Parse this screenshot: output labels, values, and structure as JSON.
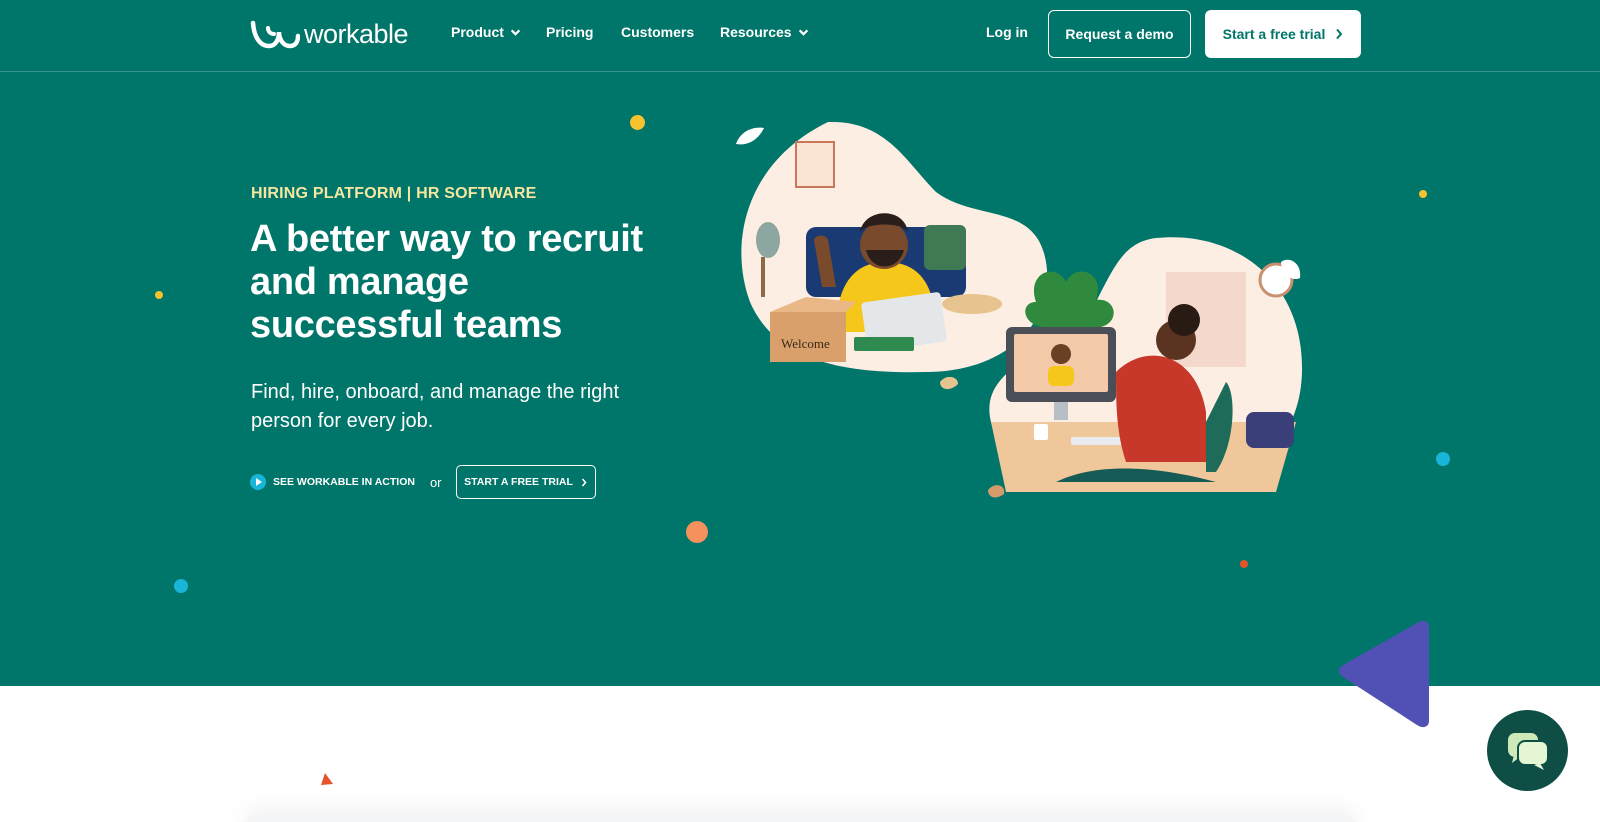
{
  "brand": {
    "name": "workable",
    "colors": {
      "hero_bg": "#00756a",
      "accent_yellow": "#f5e6a0",
      "accent_blue": "#19b5d8",
      "accent_orange": "#f4915c",
      "accent_purple": "#4f4fb0"
    }
  },
  "nav": {
    "items": [
      {
        "label": "Product",
        "has_dropdown": true
      },
      {
        "label": "Pricing",
        "has_dropdown": false
      },
      {
        "label": "Customers",
        "has_dropdown": false
      },
      {
        "label": "Resources",
        "has_dropdown": true
      }
    ],
    "login": "Log in",
    "demo": "Request a demo",
    "trial": "Start a free trial"
  },
  "hero": {
    "eyebrow": "HIRING PLATFORM | HR SOFTWARE",
    "headline": "A better way to recruit and manage successful teams",
    "subheadline": "Find, hire, onboard, and manage the right person for every job.",
    "see_action": "SEE WORKABLE IN ACTION",
    "or": "or",
    "trial_small": "START A FREE TRIAL",
    "illustration_label": "Welcome"
  },
  "chat": {
    "icon": "chat-bubbles-icon"
  }
}
